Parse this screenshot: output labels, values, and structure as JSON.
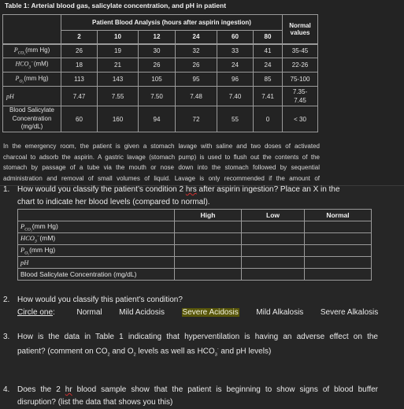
{
  "table1": {
    "caption": "Table 1: Arterial blood gas, salicylate concentration, and pH in patient",
    "group_header": "Patient Blood Analysis (hours after aspirin ingestion)",
    "normal_header": "Normal values",
    "hours": [
      "2",
      "10",
      "12",
      "24",
      "60",
      "80"
    ],
    "rows": [
      {
        "label_main": "P",
        "label_sub": "CO₂",
        "label_unit": "(mm Hg)",
        "values": [
          "26",
          "19",
          "30",
          "32",
          "33",
          "41"
        ],
        "normal": "35-45"
      },
      {
        "label_main": "HCO",
        "label_sub": "3",
        "label_sup": "−",
        "label_unit": "(mM)",
        "values": [
          "18",
          "21",
          "26",
          "26",
          "24",
          "24"
        ],
        "normal": "22-26"
      },
      {
        "label_main": "P",
        "label_sub": "O₂",
        "label_unit": "(mm Hg)",
        "values": [
          "113",
          "143",
          "105",
          "95",
          "96",
          "85"
        ],
        "normal": "75-100"
      },
      {
        "label_main": "pH",
        "values": [
          "7.47",
          "7.55",
          "7.50",
          "7.48",
          "7.40",
          "7.41"
        ],
        "normal": "7.35-7.45"
      },
      {
        "label_text": "Blood Salicylate Concentration (mg/dL)",
        "values": [
          "60",
          "160",
          "94",
          "72",
          "55",
          "0"
        ],
        "normal": "< 30"
      }
    ]
  },
  "paragraph": [
    "In the emergency room, the patient is given a stomach lavage with saline and two doses of activated",
    "charcoal to adsorb the aspirin.  A gastric lavage (stomach pump) is used to flush out the contents of the",
    "stomach by passage of a tube via the mouth or nose down into the stomach followed by sequential",
    "administration and removal of small volumes of liquid.  Lavage is only recommended if the amount of"
  ],
  "questions": {
    "q1": {
      "number": "1.",
      "line1_a": "How would you classify the patient’s condition 2 ",
      "line1_hrs": "hrs",
      "line1_b": " after aspirin ingestion?  Place an X in the",
      "line2": "chart to indicate her blood levels (compared to normal)."
    },
    "q2": {
      "number": "2.",
      "line1": "How would you classify this patient’s condition?",
      "circle_label": "Circle one",
      "choices": [
        "Normal",
        "Mild Acidosis",
        "Severe Acidosis",
        "Mild Alkalosis",
        "Severe Alkalosis"
      ],
      "highlighted_choice": "Severe Acidosis"
    },
    "q3": {
      "number": "3.",
      "line1": "How is the data in Table 1 indicating that hyperventilation is having an adverse effect on the",
      "line2_a": "patient? (comment on CO",
      "line2_b": " and O",
      "line2_c": " levels as well as HCO",
      "line2_d": " and pH levels)"
    },
    "q4": {
      "number": "4.",
      "line1_a": "Does the 2 ",
      "line1_hr": "hr",
      "line1_b": " blood sample show that the patient is beginning to show signs of blood buffer",
      "line2": "disruption? (list the data that shows you this)"
    }
  },
  "table2": {
    "columns": [
      "High",
      "Low",
      "Normal"
    ],
    "rows": [
      "Pco2 (mm Hg)",
      "HCO3- (mM)",
      "Po2 (mm Hg)",
      "pH",
      "Blood Salicylate Concentration (mg/dL)"
    ],
    "row_label_salicylate": "Blood Salicylate Concentration (mg/dL)",
    "unit_mmhg": "(mm Hg)",
    "unit_mm": "(mM)"
  }
}
